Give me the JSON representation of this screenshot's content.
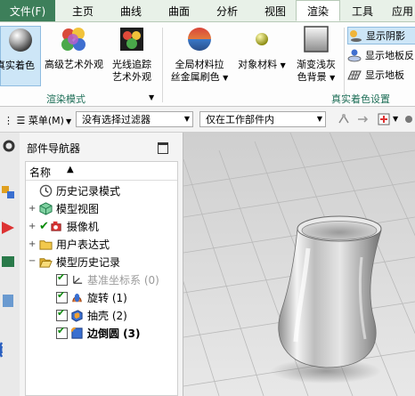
{
  "menubar": {
    "file": "文件(F)",
    "tabs": [
      "主页",
      "曲线",
      "曲面",
      "分析",
      "视图",
      "渲染",
      "工具",
      "应用"
    ],
    "active_tab": "渲染",
    "colors": {
      "file_bg": "#3d7f5a",
      "bar_bg": "#e8f1e8"
    }
  },
  "ribbon": {
    "groups": {
      "render_mode": {
        "label": "渲染模式",
        "buttons": [
          "真实着色",
          "高级艺术外观",
          "光线追踪艺术外观"
        ]
      },
      "true_shading": {
        "label": "真实着色设置",
        "buttons": [
          "全局材料拉丝金属刷色",
          "对象材料",
          "渐变浅灰色背景"
        ],
        "side_buttons": [
          "显示阴影",
          "显示地板反",
          "显示地板"
        ]
      }
    },
    "button_text": {
      "true_shade": "真实着色",
      "adv_art_1": "高级艺术外观",
      "raytrace_1": "光线追踪",
      "raytrace_2": "艺术外观",
      "global_mat_1": "全局材料拉",
      "global_mat_2": "丝金属刷色",
      "obj_mat": "对象材料",
      "gradient_bg_1": "渐变浅灰",
      "gradient_bg_2": "色背景",
      "show_shadow": "显示阴影",
      "show_floor_refl": "显示地板反",
      "show_floor": "显示地板"
    }
  },
  "selection_bar": {
    "menu_label": "菜单(M)",
    "filter_value": "没有选择过滤器",
    "scope_value": "仅在工作部件内"
  },
  "navigator": {
    "title": "部件导航器",
    "column_header": "名称",
    "items": [
      {
        "label": "历史记录模式",
        "icon": "clock-icon"
      },
      {
        "label": "模型视图",
        "icon": "model-view-icon"
      },
      {
        "label": "摄像机",
        "icon": "camera-icon"
      },
      {
        "label": "用户表达式",
        "icon": "folder-icon"
      },
      {
        "label": "模型历史记录",
        "icon": "folder-open-icon"
      },
      {
        "label": "基准坐标系 (0)",
        "icon": "datum-csys-icon"
      },
      {
        "label": "旋转 (1)",
        "icon": "revolve-icon"
      },
      {
        "label": "抽壳 (2)",
        "icon": "shell-icon"
      },
      {
        "label": "边倒圆 (3)",
        "icon": "edge-blend-icon"
      }
    ]
  }
}
